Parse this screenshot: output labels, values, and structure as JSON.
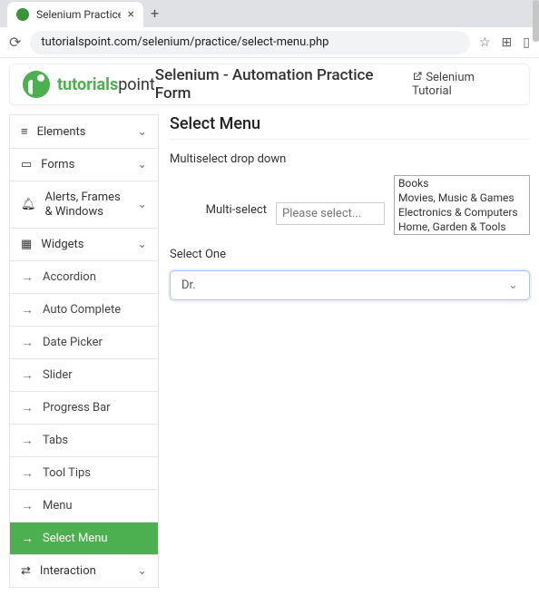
{
  "chrome": {
    "tab_title": "Selenium Practice - Select M",
    "url": "tutorialspoint.com/selenium/practice/select-menu.php"
  },
  "header": {
    "brand_green": "tutorials",
    "brand_black": "point",
    "title": "Selenium - Automation Practice Form",
    "link": "Selenium Tutorial"
  },
  "sidebar": {
    "groups": [
      {
        "label": "Elements"
      },
      {
        "label": "Forms"
      },
      {
        "label": "Alerts, Frames & Windows"
      },
      {
        "label": "Widgets"
      }
    ],
    "widgets": [
      {
        "label": "Accordion"
      },
      {
        "label": "Auto Complete"
      },
      {
        "label": "Date Picker"
      },
      {
        "label": "Slider"
      },
      {
        "label": "Progress Bar"
      },
      {
        "label": "Tabs"
      },
      {
        "label": "Tool Tips"
      },
      {
        "label": "Menu"
      },
      {
        "label": "Select Menu"
      }
    ],
    "interaction": {
      "label": "Interaction"
    }
  },
  "main": {
    "heading": "Select Menu",
    "multiselect_label": "Multiselect drop down",
    "inline_label": "Multi-select",
    "placeholder": "Please select...",
    "options": [
      "Books",
      "Movies, Music & Games",
      "Electronics & Computers",
      "Home, Garden & Tools"
    ],
    "selectone_label": "Select One",
    "selectone_value": "Dr."
  }
}
